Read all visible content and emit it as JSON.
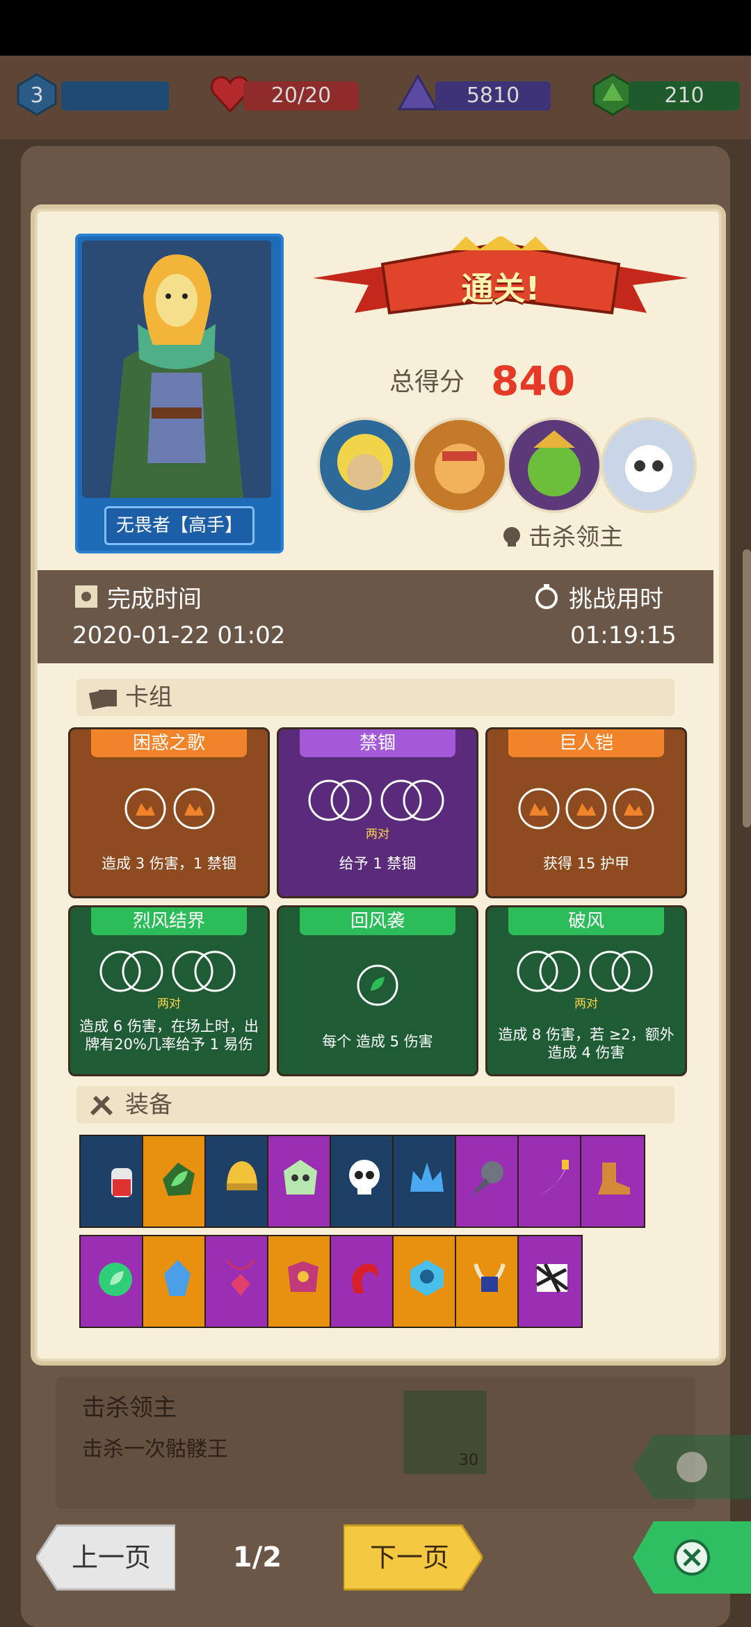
{
  "hud": {
    "level": "3",
    "health": "20/20",
    "crystals": "5810",
    "gems": "210"
  },
  "result": {
    "banner": "通关!",
    "score_label": "总得分",
    "score_value": "840",
    "kill_label": "击杀领主"
  },
  "hero": {
    "label": "无畏者【高手】"
  },
  "time": {
    "finish_label": "完成时间",
    "finish_value": "2020-01-22 01:02",
    "challenge_label": "挑战用时",
    "challenge_value": "01:19:15"
  },
  "deck": {
    "title": "卡组",
    "cards": [
      {
        "name": "困惑之歌",
        "color": "orange",
        "sub": "",
        "desc": "造成 3 伤害，1 禁锢"
      },
      {
        "name": "禁锢",
        "color": "purple",
        "sub": "两对",
        "desc": "给予 1 禁锢"
      },
      {
        "name": "巨人铠",
        "color": "orange",
        "sub": "",
        "desc": "获得 15 护甲"
      },
      {
        "name": "烈风结界",
        "color": "green",
        "sub": "两对",
        "desc": "造成 6 伤害，在场上时，出牌有20%几率给予 1 易伤"
      },
      {
        "name": "回风袭",
        "color": "green",
        "sub": "",
        "desc": "每个 造成 5 伤害"
      },
      {
        "name": "破风",
        "color": "green",
        "sub": "两对",
        "desc": "造成 8 伤害，若 ≥2，额外造成 4 伤害"
      }
    ]
  },
  "equipment": {
    "title": "装备"
  },
  "background_task": {
    "title": "击杀领主",
    "subtitle": "击杀一次骷髅王",
    "reward": "30"
  },
  "nav": {
    "prev": "上一页",
    "page": "1/2",
    "next": "下一页"
  }
}
